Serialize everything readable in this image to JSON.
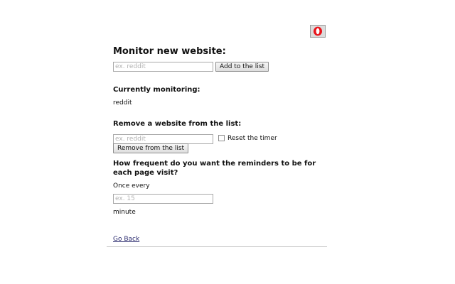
{
  "header": {
    "logo_icon": "opera-logo-icon",
    "logo_color": "#e8141b"
  },
  "monitor": {
    "title": "Monitor new website:",
    "input_placeholder": "ex. reddit",
    "add_button": "Add to the list"
  },
  "current": {
    "title": "Currently monitoring:",
    "items": [
      "reddit"
    ]
  },
  "remove": {
    "title": "Remove a website from the list:",
    "input_placeholder": "ex. reddit",
    "reset_label": "Reset the timer",
    "remove_button": "Remove from the list"
  },
  "frequency": {
    "question_line1": "How frequent do you want the reminders to be for",
    "question_line2": "each page visit?",
    "prefix": "Once every",
    "input_placeholder": "ex. 15",
    "unit": "minute"
  },
  "footer": {
    "back_link": "Go Back"
  }
}
